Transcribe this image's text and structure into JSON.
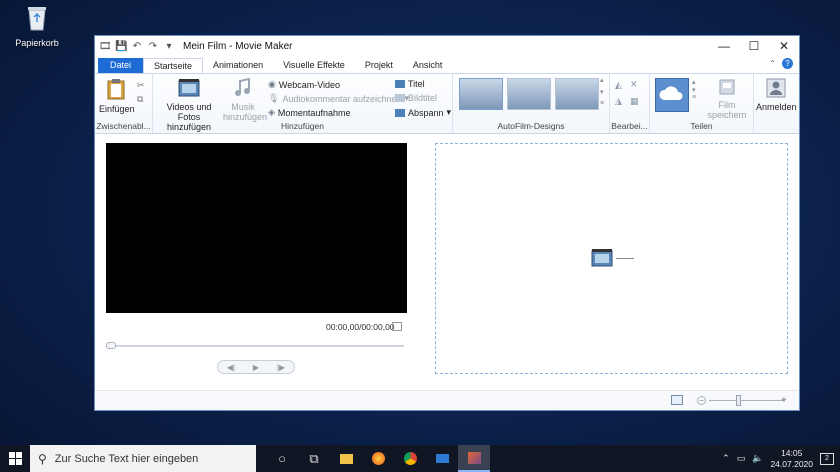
{
  "desktop": {
    "recycle_bin_label": "Papierkorb"
  },
  "window": {
    "title": "Mein Film - Movie Maker",
    "controls": {
      "minimize": "—",
      "maximize": "☐",
      "close": "✕"
    }
  },
  "tabs": [
    {
      "label": "Datei"
    },
    {
      "label": "Startseite"
    },
    {
      "label": "Animationen"
    },
    {
      "label": "Visuelle Effekte"
    },
    {
      "label": "Projekt"
    },
    {
      "label": "Ansicht"
    }
  ],
  "ribbon": {
    "clipboard": {
      "paste_label": "Einfügen",
      "group_label": "Zwischenabl..."
    },
    "add": {
      "videos_photos_label": "Videos und Fotos hinzufügen",
      "music_label": "Musik hinzufügen",
      "webcam_label": "Webcam-Video",
      "narration_label": "Audiokommentar aufzeichnen",
      "snapshot_label": "Momentaufnahme",
      "title_label": "Titel",
      "caption_label": "Bildtitel",
      "credits_label": "Abspann",
      "group_label": "Hinzufügen"
    },
    "themes": {
      "group_label": "AutoFilm-Designs"
    },
    "edit": {
      "group_label": "Bearbei..."
    },
    "share": {
      "save_movie_label": "Film speichern",
      "group_label": "Teilen"
    },
    "signin": {
      "label": "Anmelden"
    }
  },
  "player": {
    "timecode": "00:00,00/00:00,00"
  },
  "taskbar": {
    "search_placeholder": "Zur Suche Text hier eingeben",
    "time": "14:05",
    "date": "24.07.2020",
    "notification_count": "2"
  },
  "colors": {
    "file_tab": "#1e6bd6",
    "taskbar": "#101623",
    "storyboard_border": "#8fb2d6"
  }
}
